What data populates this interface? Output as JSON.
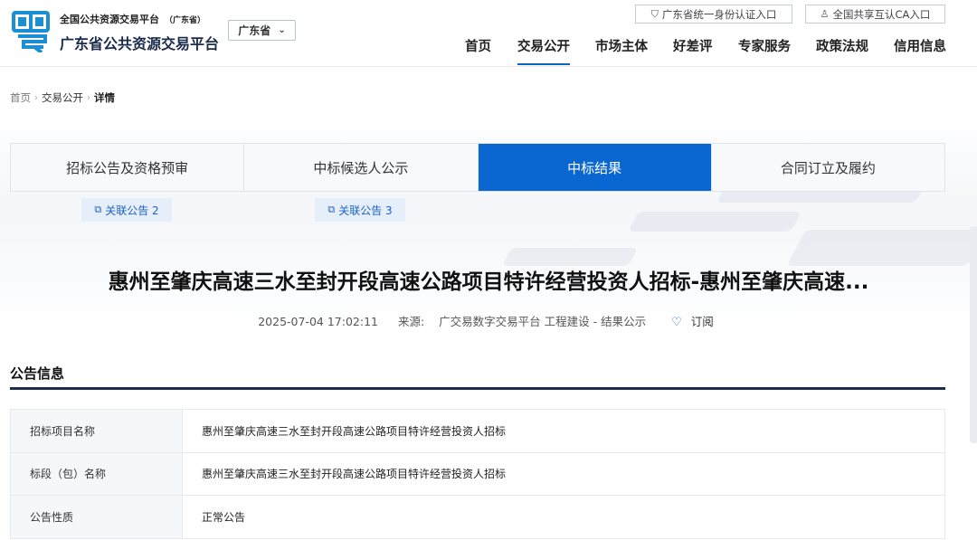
{
  "header": {
    "brand_sub": "全国公共资源交易平台",
    "brand_sub_province": "（广东省）",
    "brand_main": "广东省公共资源交易平台",
    "province_select": "广东省",
    "top_links": [
      "广东省统一身份认证入口",
      "全国共享互认CA入口"
    ],
    "nav": [
      "首页",
      "交易公开",
      "市场主体",
      "好差评",
      "专家服务",
      "政策法规",
      "信用信息"
    ],
    "nav_active": "交易公开"
  },
  "breadcrumb": [
    "首页",
    "交易公开",
    "详情"
  ],
  "tabs": {
    "items": [
      "招标公告及资格预审",
      "中标候选人公示",
      "中标结果",
      "合同订立及履约"
    ],
    "active": "中标结果"
  },
  "related": [
    "关联公告 2",
    "关联公告 3"
  ],
  "article": {
    "title": "惠州至肇庆高速三水至封开段高速公路项目特许经营投资人招标-惠州至肇庆高速...",
    "datetime": "2025-07-04 17:02:11",
    "source_label": "来源:",
    "source": "广交易数字交易平台 工程建设 - 结果公示",
    "subscribe": "订阅"
  },
  "section": {
    "title": "公告信息",
    "rows": [
      {
        "label": "招标项目名称",
        "value": "惠州至肇庆高速三水至封开段高速公路项目特许经营投资人招标"
      },
      {
        "label": "标段（包）名称",
        "value": "惠州至肇庆高速三水至封开段高速公路项目特许经营投资人招标"
      },
      {
        "label": "公告性质",
        "value": "正常公告"
      }
    ]
  },
  "colors": {
    "accent": "#0a66d0",
    "nav_underline": "#0a66c2",
    "section_rule": "#1b2c4c",
    "related_bg": "#e6eef9"
  }
}
